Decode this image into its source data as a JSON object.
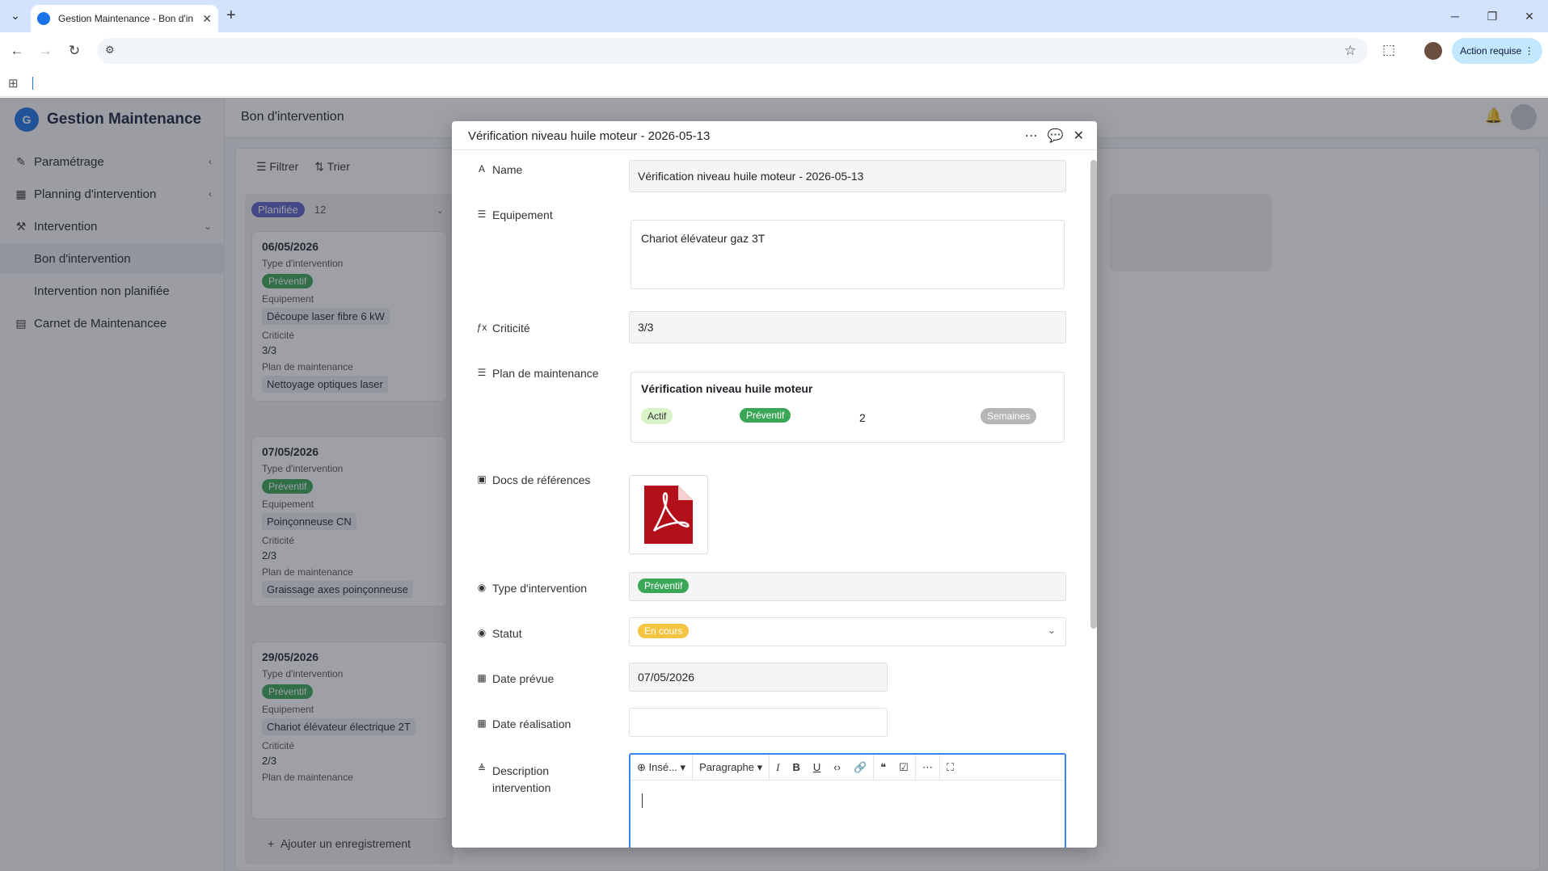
{
  "browser": {
    "tab_title": "Gestion Maintenance - Bon d'in",
    "action_label": "Action requise"
  },
  "app": {
    "brand": "Gestion Maintenance",
    "page_title": "Bon d'intervention",
    "sidebar": [
      {
        "label": "Paramétrage"
      },
      {
        "label": "Planning d'intervention"
      },
      {
        "label": "Intervention"
      },
      {
        "label": "Bon d'intervention"
      },
      {
        "label": "Intervention non planifiée"
      },
      {
        "label": "Carnet de Maintenancee"
      }
    ],
    "filters": {
      "filter": "Filtrer",
      "sort": "Trier"
    },
    "column": {
      "status": "Planifiée",
      "count": "12",
      "add_record": "Ajouter un enregistrement",
      "cards": [
        {
          "date": "06/05/2026",
          "type_label": "Type d'intervention",
          "type": "Préventif",
          "equip_label": "Equipement",
          "equip": "Découpe laser fibre 6 kW",
          "crit_label": "Criticité",
          "crit": "3/3",
          "plan_label": "Plan de maintenance",
          "plan": "Nettoyage optiques laser"
        },
        {
          "date": "07/05/2026",
          "type_label": "Type d'intervention",
          "type": "Préventif",
          "equip_label": "Equipement",
          "equip": "Poinçonneuse CN",
          "crit_label": "Criticité",
          "crit": "2/3",
          "plan_label": "Plan de maintenance",
          "plan": "Graissage axes poinçonneuse"
        },
        {
          "date": "29/05/2026",
          "type_label": "Type d'intervention",
          "type": "Préventif",
          "equip_label": "Equipement",
          "equip": "Chariot élévateur électrique 2T",
          "crit_label": "Criticité",
          "crit": "2/3",
          "plan_label": "Plan de maintenance"
        }
      ]
    }
  },
  "modal": {
    "title": "Vérification niveau huile moteur - 2026-05-13",
    "fields": {
      "name_label": "Name",
      "name_value": "Vérification niveau huile moteur - 2026-05-13",
      "equip_label": "Equipement",
      "equip_value": "Chariot élévateur gaz 3T",
      "crit_label": "Criticité",
      "crit_value": "3/3",
      "plan_label": "Plan de maintenance",
      "plan_title": "Vérification niveau huile moteur",
      "plan_status": "Actif",
      "plan_type": "Préventif",
      "plan_freq": "2",
      "plan_unit": "Semaines",
      "docs_label": "Docs de références",
      "type_label": "Type d'intervention",
      "type_value": "Préventif",
      "status_label": "Statut",
      "status_value": "En cours",
      "date_planned_label": "Date prévue",
      "date_planned_value": "07/05/2026",
      "date_done_label": "Date réalisation",
      "date_done_value": "",
      "desc_label_1": "Description",
      "desc_label_2": "intervention"
    },
    "editor": {
      "insert": "Insé...",
      "paragraph": "Paragraphe"
    }
  },
  "colors": {
    "accent": "#1a73e8",
    "preventif": "#3aa757",
    "encours": "#f5c542",
    "planifiee": "#5b5fc7"
  }
}
